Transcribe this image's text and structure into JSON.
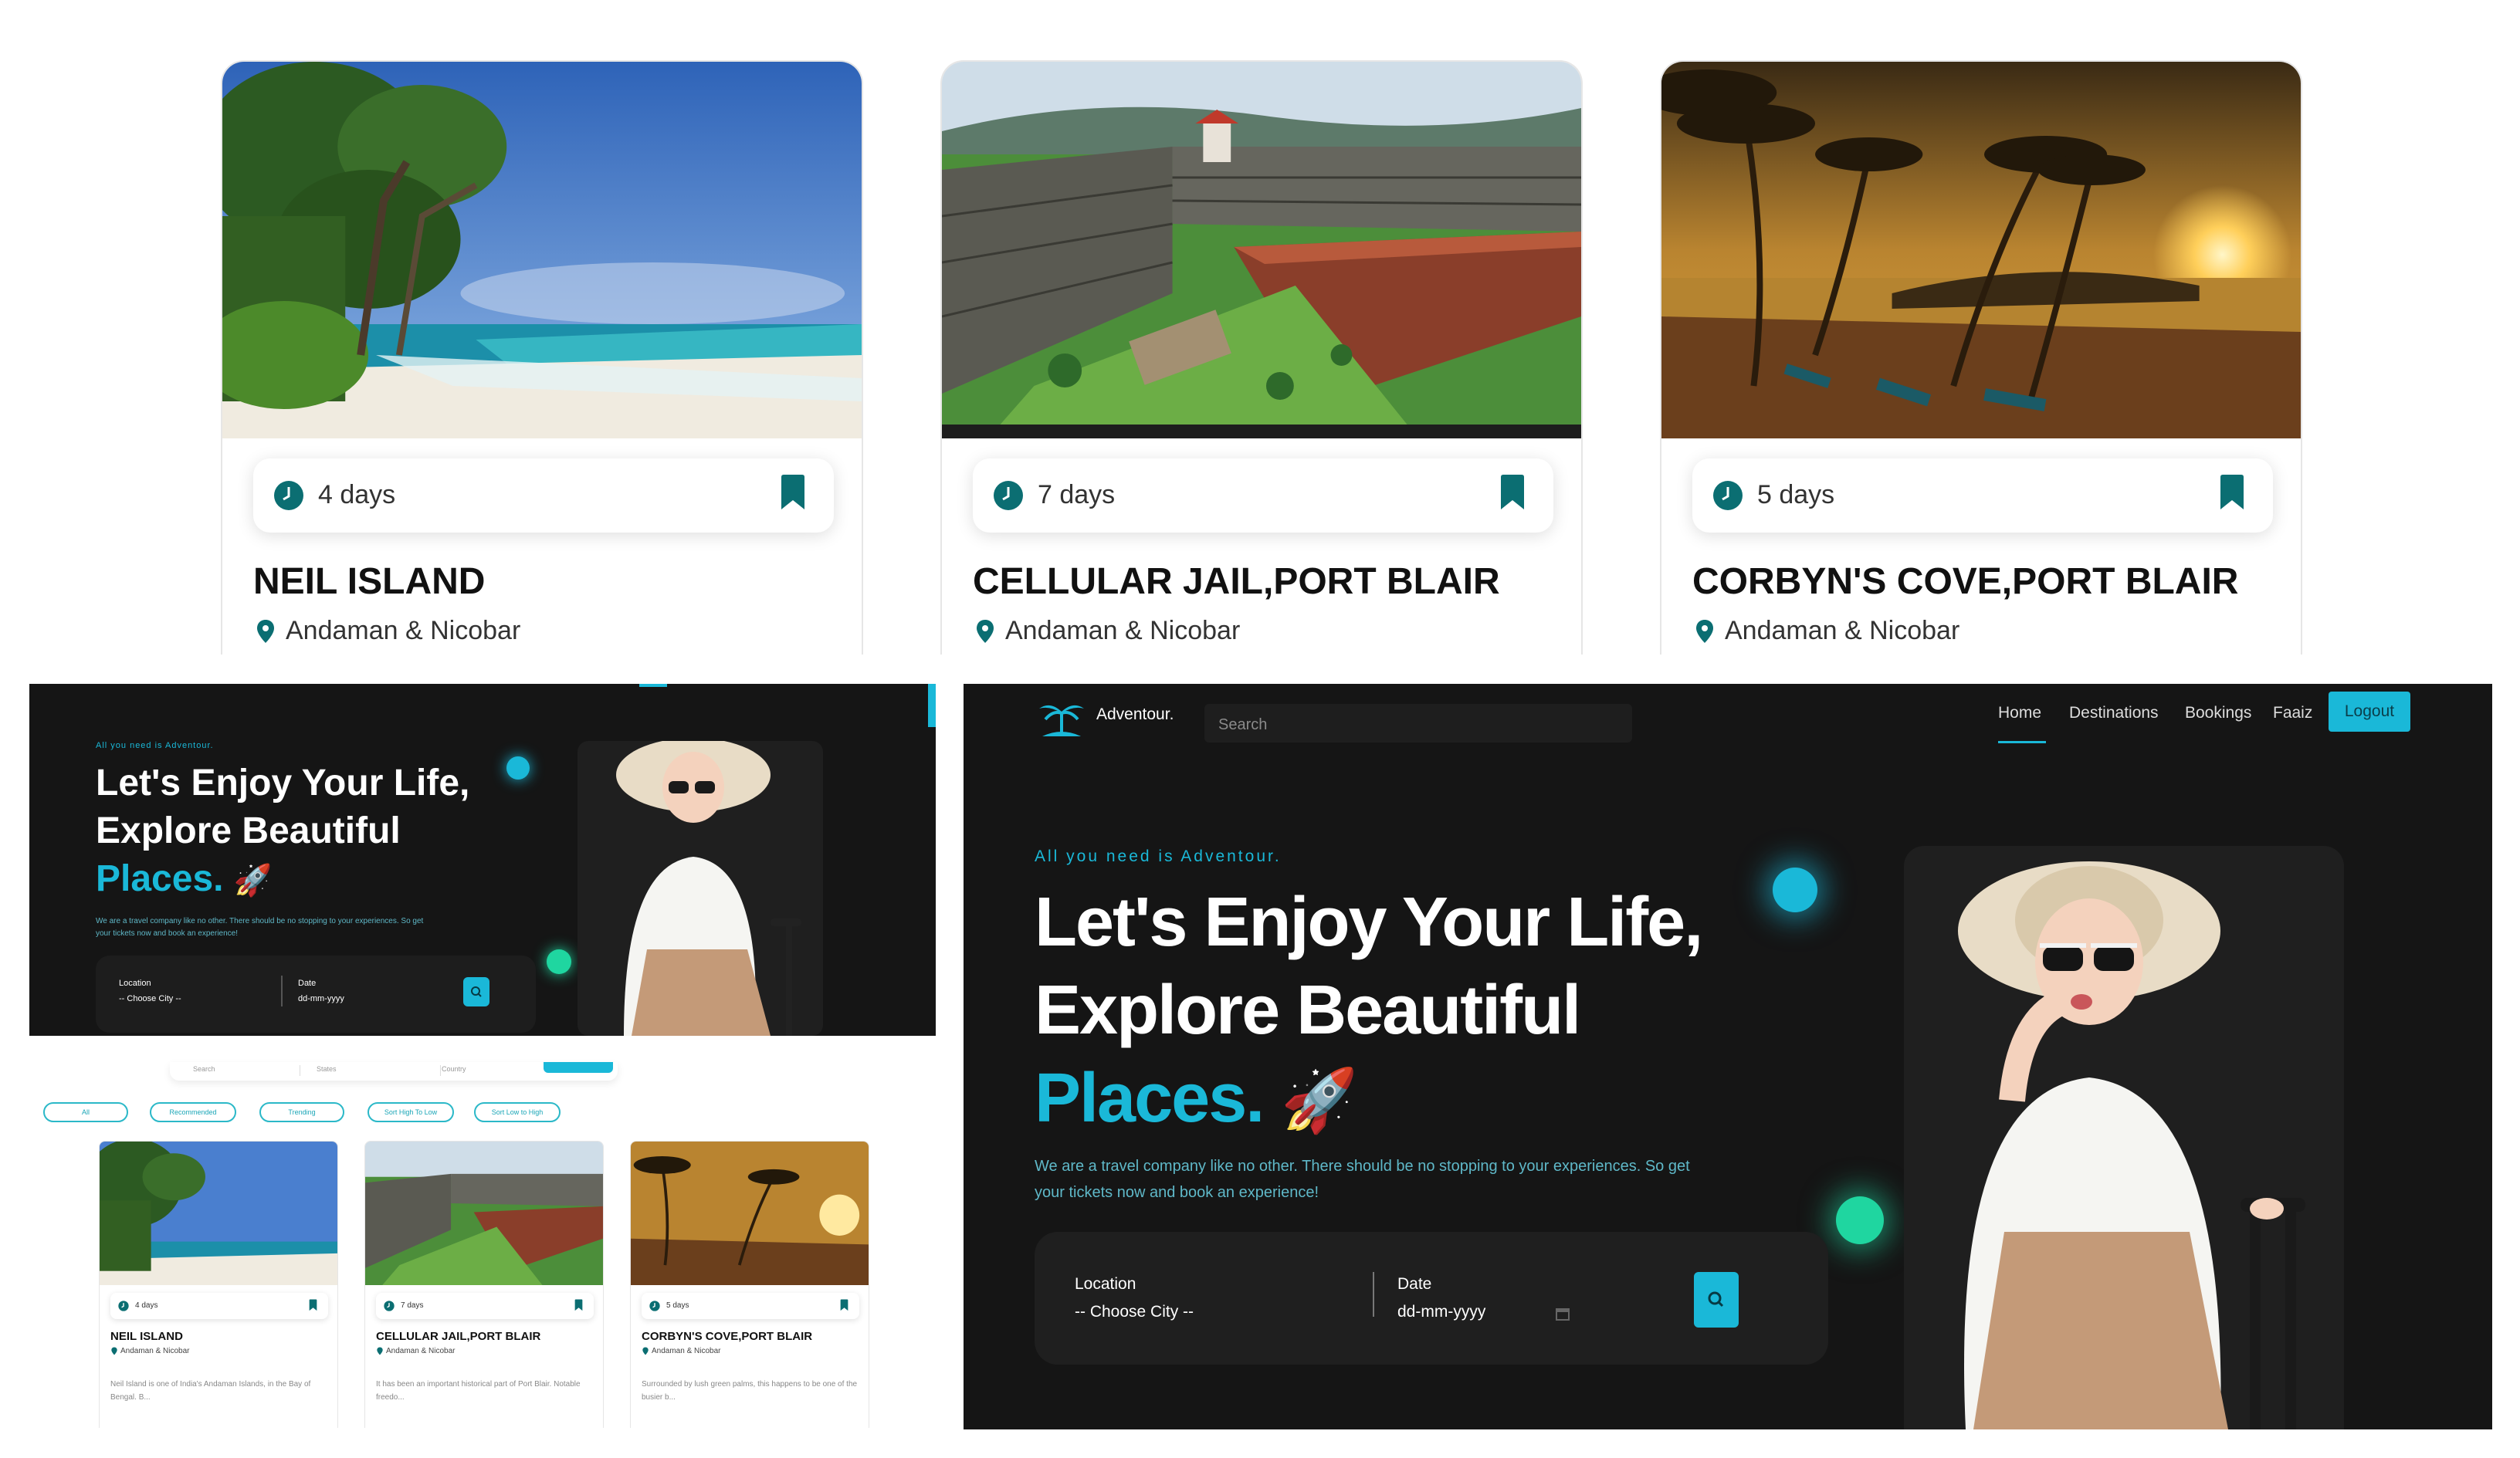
{
  "cards": [
    {
      "days": "4 days",
      "name": "NEIL ISLAND",
      "state": "Andaman & Nicobar",
      "desc": "Neil Island is one of India's Andaman Islands, in the Bay of Bengal. B..."
    },
    {
      "days": "7 days",
      "name": "CELLULAR JAIL,PORT BLAIR",
      "state": "Andaman & Nicobar",
      "desc": "It has been an important historical part of Port Blair. Notable freedo..."
    },
    {
      "days": "5 days",
      "name": "CORBYN'S COVE,PORT BLAIR",
      "state": "Andaman & Nicobar",
      "desc": "Surrounded by lush green palms, this happens to be one of the busier b..."
    }
  ],
  "nav": {
    "brand": "Adventour.",
    "search_placeholder": "Search",
    "links": [
      "Home",
      "Destinations",
      "Bookings",
      "Faaiz"
    ],
    "logout": "Logout"
  },
  "hero": {
    "tagline": "All you need is Adventour.",
    "line1": "Let's Enjoy Your Life,",
    "line2": "Explore Beautiful",
    "line3": "Places.",
    "desc1": "We are a travel company like no other. There should be no stopping to your experiences. So get",
    "desc2": "your tickets now and book an experience!",
    "location_label": "Location",
    "location_value": "-- Choose City --",
    "date_label": "Date",
    "date_value": "dd-mm-yyyy"
  },
  "filters": {
    "search": "Search",
    "states": "States",
    "country": "Country",
    "chips": [
      "All",
      "Recommended",
      "Trending",
      "Sort High To Low",
      "Sort Low to High"
    ]
  },
  "colors": {
    "accent": "#1ab8d8",
    "dark_bg": "#151515",
    "teal": "#0b6e72",
    "green_glow": "#1fd6a0"
  }
}
